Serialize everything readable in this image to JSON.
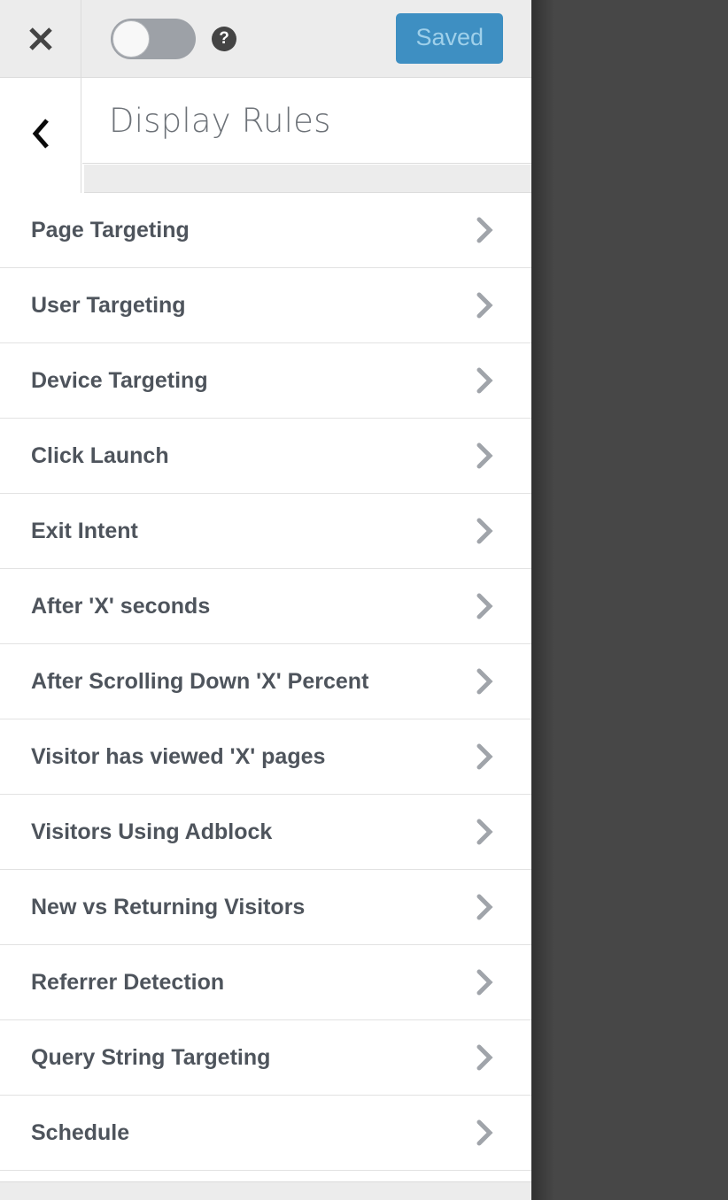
{
  "panel": {
    "title": "Display Rules",
    "toolbar": {
      "close_icon": "close-x-icon",
      "toggle": {
        "name": "enable-toggle",
        "state": "off"
      },
      "help_icon": "question-mark-circle-icon",
      "help_glyph": "?",
      "save_button_label": "Saved"
    },
    "back_icon": "chevron-left-icon",
    "row_chevron_icon": "chevron-right-icon"
  },
  "rules": [
    {
      "label": "Page Targeting"
    },
    {
      "label": "User Targeting"
    },
    {
      "label": "Device Targeting"
    },
    {
      "label": "Click Launch"
    },
    {
      "label": "Exit Intent"
    },
    {
      "label": "After 'X' seconds"
    },
    {
      "label": "After Scrolling Down 'X' Percent"
    },
    {
      "label": "Visitor has viewed 'X' pages"
    },
    {
      "label": "Visitors Using Adblock"
    },
    {
      "label": "New vs Returning Visitors"
    },
    {
      "label": "Referrer Detection"
    },
    {
      "label": "Query String Targeting"
    },
    {
      "label": "Schedule"
    }
  ],
  "colors": {
    "overlay": "#474747",
    "panel_bg": "#ffffff",
    "toolbar_bg": "#ececec",
    "divider": "#e2e2e2",
    "accent_button": "#3e8fc2",
    "accent_button_text": "#9fd0ea",
    "label_text": "#4e545c",
    "title_text": "#6d7278",
    "chevron": "#a0a4aa",
    "toggle_track": "#9da1a7",
    "toggle_knob": "#f8f8f8"
  }
}
